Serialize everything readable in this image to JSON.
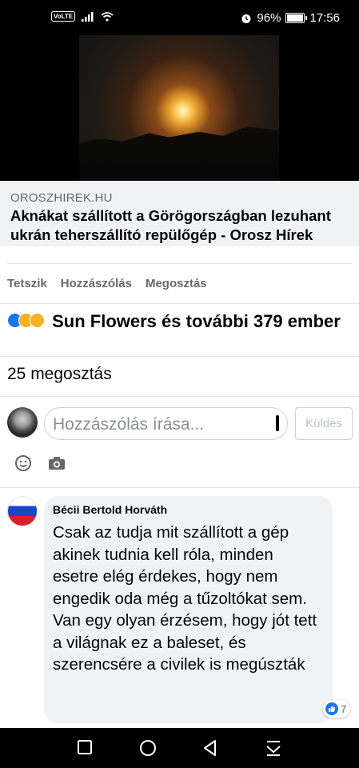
{
  "status_bar": {
    "volte": "VoLTE",
    "battery": "96%",
    "time": "17:56",
    "battery_level": 0.96
  },
  "link_preview": {
    "domain": "OROSZHIREK.HU",
    "title": "Aknákat szállított a Görögországban lezuhant ukrán teherszállító repülőgép - Orosz Hírek"
  },
  "actions": {
    "like": "Tetszik",
    "comment": "Hozzászólás",
    "share": "Megosztás"
  },
  "reactions": {
    "summary": "Sun Flowers és további 379 ember",
    "icons": [
      "like-icon",
      "wow-icon",
      "haha-icon"
    ],
    "colors": {
      "like": "#1877f2",
      "emoji": "#f7b125"
    }
  },
  "shares": "25 megosztás",
  "composer": {
    "placeholder": "Hozzászólás írása...",
    "send_label": "Küldés"
  },
  "comment": {
    "author": "Bécii Bertold Horváth",
    "text": "Csak az tudja mit szállított a gép akinek tudnia kell róla, minden esetre elég érdekes, hogy nem engedik oda még a tűzoltókat sem. Van egy olyan érzésem, hogy jót tett a világnak ez a baleset, és szerencsére a civilek is megúszták",
    "like_count": "7"
  }
}
